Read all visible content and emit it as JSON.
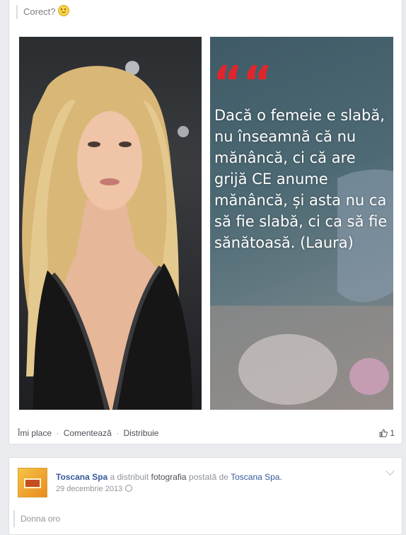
{
  "post1": {
    "caption": "Corect?",
    "photo": {
      "quote_marks": "““",
      "quote_text": "Dacă o femeie e slabă, nu înseamnă că nu mănâncă, ci că are grijă CE anume mănâncă, și asta nu ca să fie slabă, ci ca să fie sănătoasă. (Laura)"
    },
    "actions": {
      "like": "Îmi place",
      "comment": "Comentează",
      "share": "Distribuie",
      "separator": "·"
    },
    "like_count": "1"
  },
  "post2": {
    "author": "Toscana Spa",
    "action_text": "a distribuit",
    "object_text": "fotografia",
    "posted_by_text": "postată de",
    "source_page": "Toscana Spa.",
    "date": "29 decembrie 2013",
    "caption": "Donna oro"
  },
  "colors": {
    "link": "#365899",
    "quote_red": "#e2252b",
    "background": "#e9ebee"
  }
}
